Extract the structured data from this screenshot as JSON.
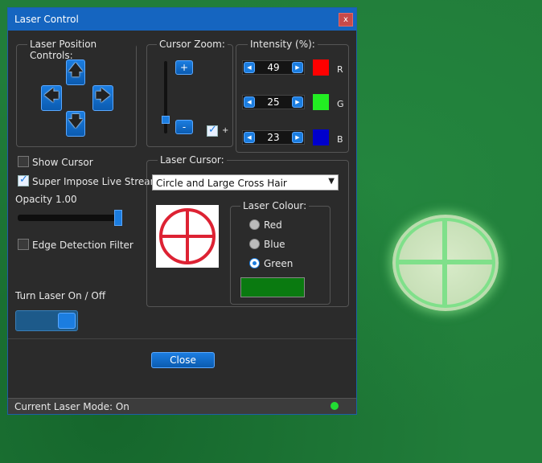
{
  "window": {
    "title": "Laser Control",
    "close_glyph": "x"
  },
  "position_controls": {
    "label": "Laser Position Controls:",
    "up_icon": "arrow-up-icon",
    "down_icon": "arrow-down-icon",
    "left_icon": "arrow-left-icon",
    "right_icon": "arrow-right-icon"
  },
  "cursor_zoom": {
    "label": "Cursor Zoom:",
    "plus_label": "+",
    "minus_label": "-",
    "lock_suffix": "+",
    "lock_checked": true,
    "zoom_level": 0.15
  },
  "intensity": {
    "label": "Intensity (%):",
    "channels": [
      {
        "name": "R",
        "value": "49",
        "color": "#ff0000"
      },
      {
        "name": "G",
        "value": "25",
        "color": "#22ee22"
      },
      {
        "name": "B",
        "value": "23",
        "color": "#0000cc"
      }
    ]
  },
  "options": {
    "show_cursor": {
      "label": "Show Cursor",
      "checked": false
    },
    "super_impose": {
      "label": "Super Impose Live Stream",
      "checked": true
    },
    "opacity_label": "Opacity 1.00",
    "opacity_value": 1.0,
    "edge_detection": {
      "label": "Edge Detection Filter",
      "checked": false
    }
  },
  "laser_toggle": {
    "label": "Turn Laser On / Off",
    "on": true
  },
  "laser_cursor": {
    "label": "Laser Cursor:",
    "selected": "Circle and Large Cross Hair",
    "preview_color": "#dd2233",
    "colour_group_label": "Laser Colour:",
    "colours": [
      {
        "label": "Red",
        "selected": false
      },
      {
        "label": "Blue",
        "selected": false
      },
      {
        "label": "Green",
        "selected": true
      }
    ],
    "colour_swatch": "#0a7a10"
  },
  "footer": {
    "close_button": "Close",
    "status": "Current Laser Mode: On",
    "status_led_color": "#22dd33"
  }
}
